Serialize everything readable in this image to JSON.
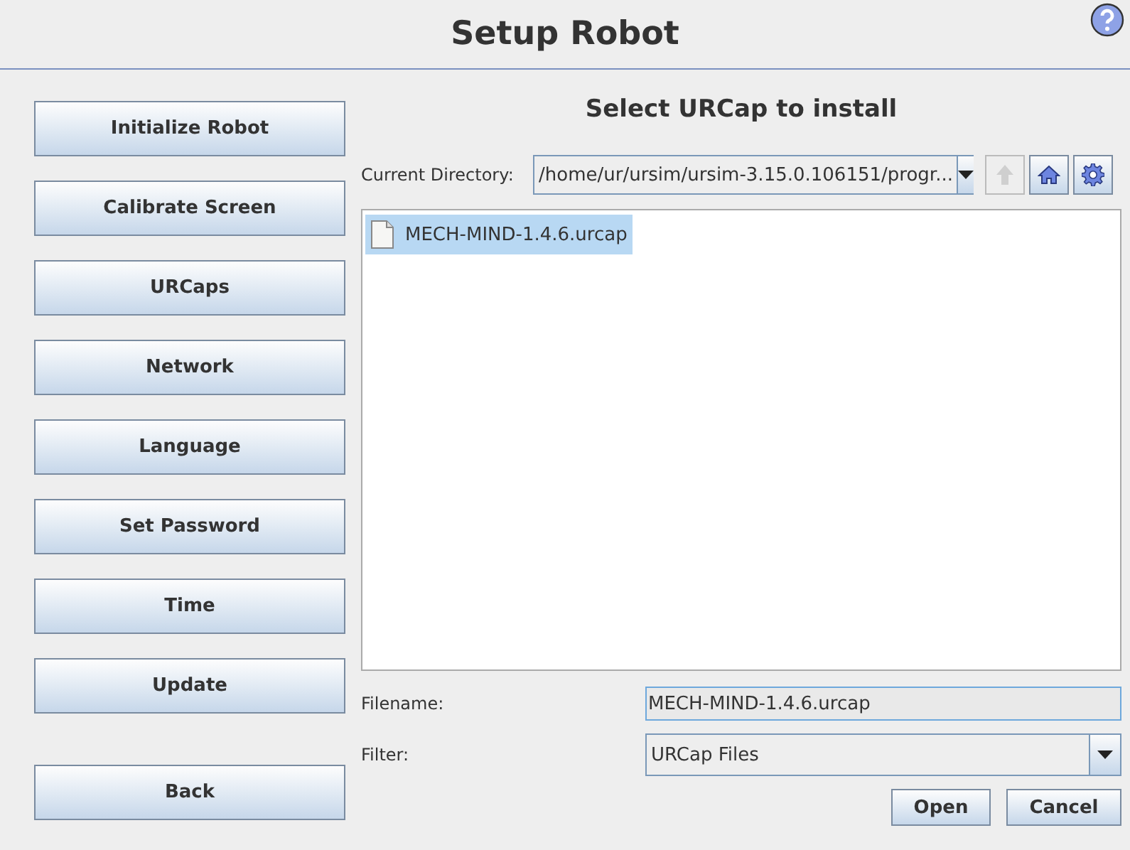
{
  "header": {
    "title": "Setup Robot"
  },
  "menu": [
    {
      "label": "Initialize Robot"
    },
    {
      "label": "Calibrate Screen"
    },
    {
      "label": "URCaps"
    },
    {
      "label": "Network"
    },
    {
      "label": "Language"
    },
    {
      "label": "Set Password"
    },
    {
      "label": "Time"
    },
    {
      "label": "Update"
    }
  ],
  "back_button": "Back",
  "dialog": {
    "title": "Select URCap to install",
    "directory_label": "Current Directory:",
    "directory": "/home/ur/ursim/ursim-3.15.0.106151/progr...",
    "toolbar": [
      {
        "kind": "up",
        "disabled": true
      },
      {
        "kind": "home",
        "disabled": false
      },
      {
        "kind": "settings",
        "disabled": false
      }
    ],
    "files": [
      {
        "name": "MECH-MIND-1.4.6.urcap",
        "selected": true
      }
    ],
    "filename_label": "Filename:",
    "filename": "MECH-MIND-1.4.6.urcap",
    "filter_label": "Filter:",
    "filter": "URCap Files",
    "buttons": [
      "Open",
      "Cancel"
    ]
  }
}
